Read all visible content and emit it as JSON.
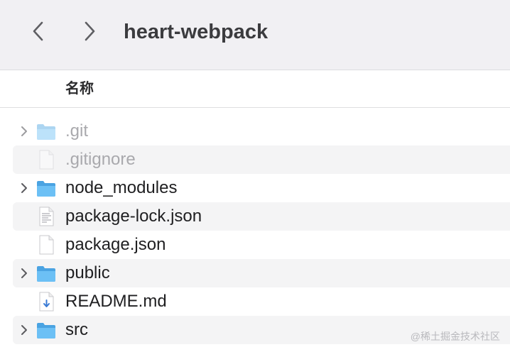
{
  "window": {
    "title": "heart-webpack"
  },
  "header": {
    "name_column": "名称"
  },
  "files": [
    {
      "name": ".git",
      "kind": "folder",
      "expandable": true,
      "dimmed": true
    },
    {
      "name": ".gitignore",
      "kind": "file",
      "expandable": false,
      "dimmed": true
    },
    {
      "name": "node_modules",
      "kind": "folder",
      "expandable": true,
      "dimmed": false
    },
    {
      "name": "package-lock.json",
      "kind": "document",
      "expandable": false,
      "dimmed": false
    },
    {
      "name": "package.json",
      "kind": "file",
      "expandable": false,
      "dimmed": false
    },
    {
      "name": "public",
      "kind": "folder",
      "expandable": true,
      "dimmed": false
    },
    {
      "name": "README.md",
      "kind": "markdown",
      "expandable": false,
      "dimmed": false
    },
    {
      "name": "src",
      "kind": "folder",
      "expandable": true,
      "dimmed": false
    }
  ],
  "watermark": "@稀土掘金技术社区",
  "colors": {
    "folder": "#4aa3e2",
    "toolbar_bg": "#f1f0f3",
    "row_alt": "#f4f4f5"
  }
}
